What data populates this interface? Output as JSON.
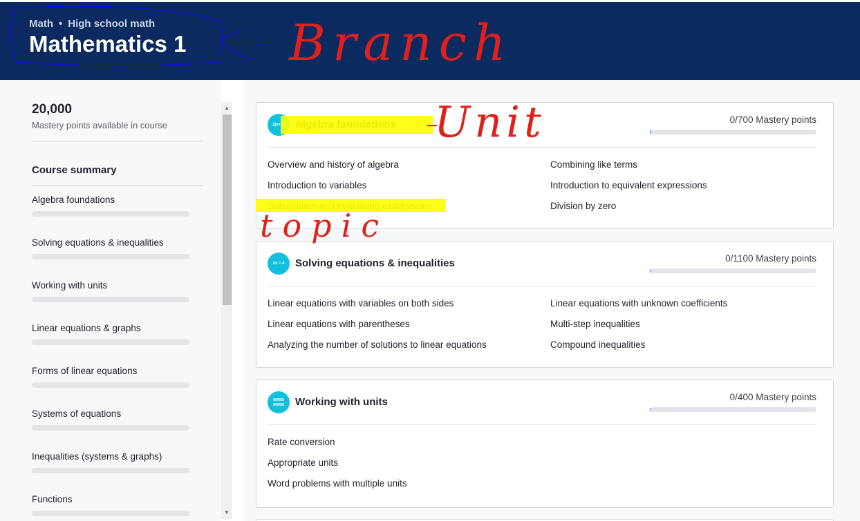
{
  "header": {
    "breadcrumb": [
      "Math",
      "High school math"
    ],
    "breadcrumb_separator": "•",
    "title": "Mathematics 1",
    "background_color": "#0b2a5f"
  },
  "annotations": {
    "branch_label": "Branch",
    "unit_label": "Unit",
    "topic_label": "topic",
    "ink_color": "#e0201b",
    "outline_color": "#1010d0",
    "highlight_color": "#ffff00"
  },
  "sidebar": {
    "points_total": "20,000",
    "points_caption": "Mastery points available in course",
    "summary_title": "Course summary",
    "items": [
      {
        "label": "Algebra foundations",
        "progress": 0
      },
      {
        "label": "Solving equations & inequalities",
        "progress": 0
      },
      {
        "label": "Working with units",
        "progress": 0
      },
      {
        "label": "Linear equations & graphs",
        "progress": 0
      },
      {
        "label": "Forms of linear equations",
        "progress": 0
      },
      {
        "label": "Systems of equations",
        "progress": 0
      },
      {
        "label": "Inequalities (systems & graphs)",
        "progress": 0
      },
      {
        "label": "Functions",
        "progress": 0
      }
    ]
  },
  "units": [
    {
      "title": "Algebra foundations",
      "icon": "algebra-expression-icon",
      "icon_text": "2(x+3)",
      "mastery": "0/700 Mastery points",
      "progress": 0,
      "topics_left": [
        "Overview and history of algebra",
        "Introduction to variables",
        "Substitution and evaluating expressions"
      ],
      "topics_right": [
        "Combining like terms",
        "Introduction to equivalent expressions",
        "Division by zero"
      ]
    },
    {
      "title": "Solving equations & inequalities",
      "icon": "equation-icon",
      "icon_text": "2x = 4",
      "mastery": "0/1100 Mastery points",
      "progress": 0,
      "topics_left": [
        "Linear equations with variables on both sides",
        "Linear equations with parentheses",
        "Analyzing the number of solutions to linear equations"
      ],
      "topics_right": [
        "Linear equations with unknown coefficients",
        "Multi-step inequalities",
        "Compound inequalities"
      ]
    },
    {
      "title": "Working with units",
      "icon": "units-icon",
      "icon_text": "",
      "mastery": "0/400 Mastery points",
      "progress": 0,
      "topics_left": [
        "Rate conversion",
        "Appropriate units",
        "Word problems with multiple units"
      ],
      "topics_right": []
    }
  ]
}
